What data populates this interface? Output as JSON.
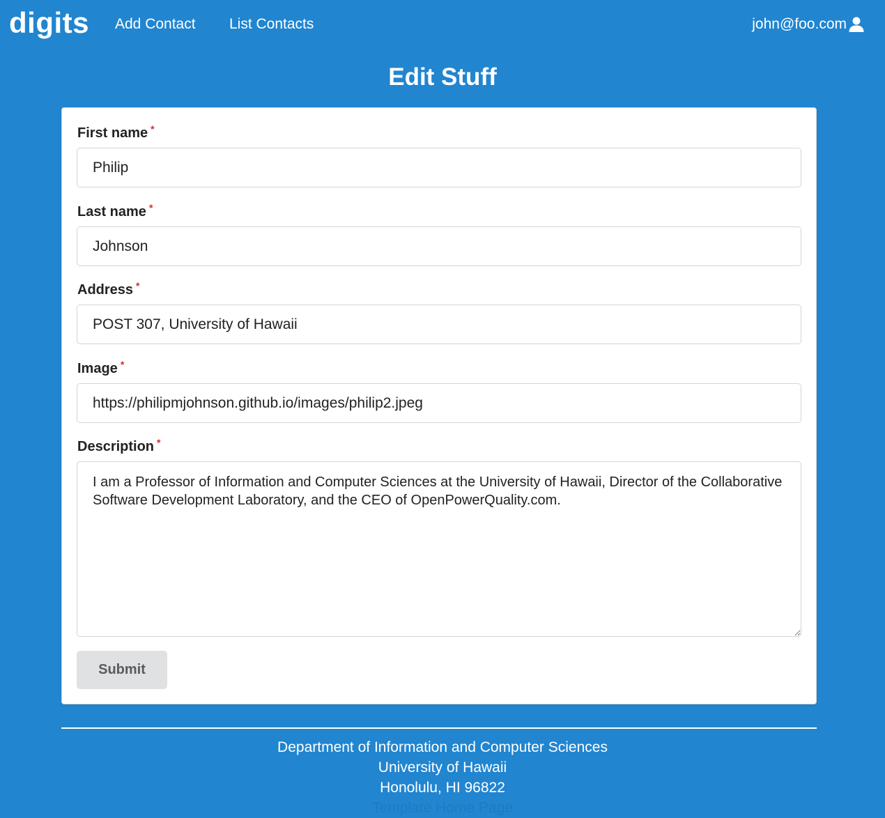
{
  "nav": {
    "brand": "digits",
    "add_contact": "Add Contact",
    "list_contacts": "List Contacts",
    "user_email": "john@foo.com",
    "user_icon": "user-icon"
  },
  "page": {
    "title": "Edit Stuff"
  },
  "form": {
    "first_name": {
      "label": "First name",
      "required": "*",
      "value": "Philip"
    },
    "last_name": {
      "label": "Last name",
      "required": "*",
      "value": "Johnson"
    },
    "address": {
      "label": "Address",
      "required": "*",
      "value": "POST 307, University of Hawaii"
    },
    "image": {
      "label": "Image",
      "required": "*",
      "value": "https://philipmjohnson.github.io/images/philip2.jpeg"
    },
    "description": {
      "label": "Description",
      "required": "*",
      "value": "I am a Professor of Information and Computer Sciences at the University of Hawaii, Director of the Collaborative Software Development Laboratory, and the CEO of OpenPowerQuality.com."
    },
    "submit_label": "Submit"
  },
  "footer": {
    "line1": "Department of Information and Computer Sciences",
    "line2": "University of Hawaii",
    "line3": "Honolulu, HI 96822",
    "link": "Template Home Page"
  },
  "colors": {
    "background": "#2185d0",
    "required": "#db2828",
    "button": "#e0e1e2"
  }
}
